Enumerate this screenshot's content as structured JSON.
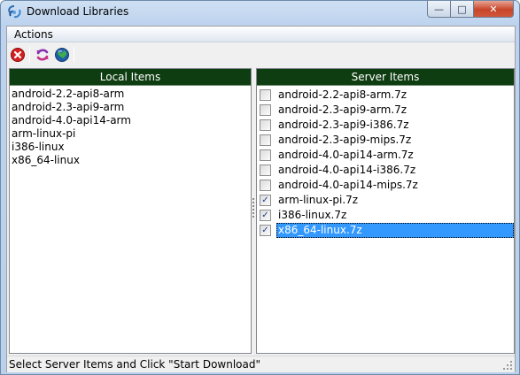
{
  "window": {
    "title": "Download Libraries",
    "minimize_glyph": "—",
    "maximize_glyph": "□",
    "close_glyph": "✕"
  },
  "menu": {
    "items": [
      {
        "label": "Actions"
      }
    ]
  },
  "toolbar": {
    "buttons": [
      {
        "name": "stop-icon",
        "color": "#d42020"
      },
      {
        "name": "refresh-icon",
        "color": "#8a2fb0"
      },
      {
        "name": "globe-icon",
        "color": "#1f5fa8"
      }
    ]
  },
  "local_panel": {
    "header": "Local Items",
    "items": [
      "android-2.2-api8-arm",
      "android-2.3-api9-arm",
      "android-4.0-api14-arm",
      "arm-linux-pi",
      "i386-linux",
      "x86_64-linux"
    ]
  },
  "server_panel": {
    "header": "Server Items",
    "items": [
      {
        "label": "android-2.2-api8-arm.7z",
        "checked": false,
        "selected": false
      },
      {
        "label": "android-2.3-api9-arm.7z",
        "checked": false,
        "selected": false
      },
      {
        "label": "android-2.3-api9-i386.7z",
        "checked": false,
        "selected": false
      },
      {
        "label": "android-2.3-api9-mips.7z",
        "checked": false,
        "selected": false
      },
      {
        "label": "android-4.0-api14-arm.7z",
        "checked": false,
        "selected": false
      },
      {
        "label": "android-4.0-api14-i386.7z",
        "checked": false,
        "selected": false
      },
      {
        "label": "android-4.0-api14-mips.7z",
        "checked": false,
        "selected": false
      },
      {
        "label": "arm-linux-pi.7z",
        "checked": true,
        "selected": false
      },
      {
        "label": "i386-linux.7z",
        "checked": true,
        "selected": false
      },
      {
        "label": "x86_64-linux.7z",
        "checked": true,
        "selected": true
      }
    ]
  },
  "status": {
    "text": "Select Server Items and Click \"Start Download\""
  },
  "colors": {
    "header_bg": "#0f3d12",
    "selection": "#3399ff"
  }
}
